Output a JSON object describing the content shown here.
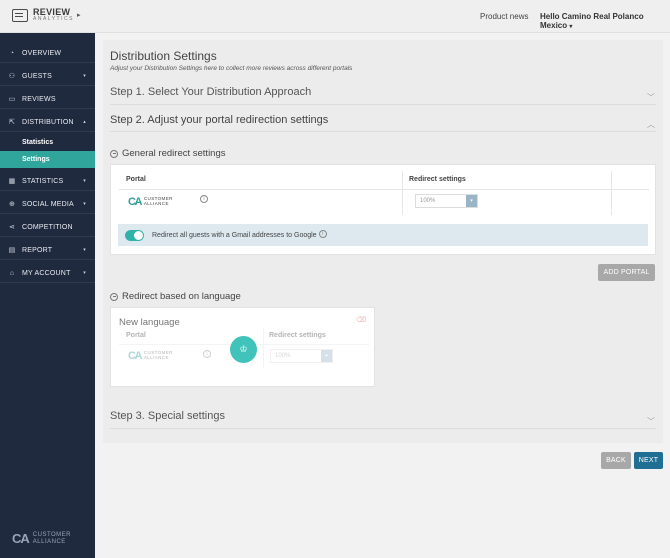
{
  "app": {
    "logo_line1": "REVIEW",
    "logo_line2": "ANALYTICS",
    "collapse_icon": "chevron-right-icon"
  },
  "topbar": {
    "product_news": "Product news",
    "hotel": "Hello Camino Real Polanco Mexico",
    "hotel_caret": "▾"
  },
  "sidebar": {
    "items": [
      {
        "label": "OVERVIEW",
        "icon": "dashboard-icon",
        "glyph": "◔",
        "chevron": ""
      },
      {
        "label": "GUESTS",
        "icon": "user-icon",
        "glyph": "⚇",
        "chevron": "▾"
      },
      {
        "label": "REVIEWS",
        "icon": "chat-icon",
        "glyph": "▭",
        "chevron": ""
      },
      {
        "label": "DISTRIBUTION",
        "icon": "export-icon",
        "glyph": "⇱",
        "chevron": "▴"
      },
      {
        "label": "STATISTICS",
        "icon": "bar-chart-icon",
        "glyph": "▦",
        "chevron": "▾"
      },
      {
        "label": "SOCIAL MEDIA",
        "icon": "globe-icon",
        "glyph": "⊕",
        "chevron": "▾"
      },
      {
        "label": "COMPETITION",
        "icon": "share-icon",
        "glyph": "⋖",
        "chevron": ""
      },
      {
        "label": "REPORT",
        "icon": "report-icon",
        "glyph": "▤",
        "chevron": "▾"
      },
      {
        "label": "MY ACCOUNT",
        "icon": "home-icon",
        "glyph": "⌂",
        "chevron": "▾"
      }
    ],
    "sub_items": [
      {
        "label": "Statistics",
        "active": false
      },
      {
        "label": "Settings",
        "active": true
      }
    ],
    "footer_mark": "CA",
    "footer_line1": "CUSTOMER",
    "footer_line2": "ALLIANCE"
  },
  "main": {
    "title": "Distribution Settings",
    "subtitle": "Adjust your Distribution Settings here to collect more reviews across different portals",
    "step1": "Step 1. Select Your Distribution Approach",
    "step2": "Step 2. Adjust your portal redirection settings",
    "step3": "Step 3. Special settings",
    "caret_down": "﹀",
    "caret_up": "︿",
    "general": {
      "heading": "General redirect settings",
      "col_portal": "Portal",
      "col_redirect": "Redirect settings",
      "portal_mark": "CA",
      "portal_line1": "CUSTOMER",
      "portal_line2": "ALLIANCE",
      "info_glyph": "i",
      "select_value": "100%",
      "select_caret": "▾",
      "gmail_label": "Redirect all guests with a Gmail addresses to Google",
      "toggle_on": true
    },
    "add_portal": "ADD PORTAL",
    "language": {
      "heading": "Redirect based on language",
      "new_language": "New language",
      "col_portal": "Portal",
      "col_redirect": "Redirect settings",
      "portal_mark": "CA",
      "portal_line1": "CUSTOMER",
      "portal_line2": "ALLIANCE",
      "info_glyph": "i",
      "select_value": "100%",
      "select_caret": "▾",
      "add_glyph": "♔",
      "trash_glyph": "⌫"
    }
  },
  "footer_buttons": {
    "back": "BACK",
    "next": "NEXT"
  }
}
